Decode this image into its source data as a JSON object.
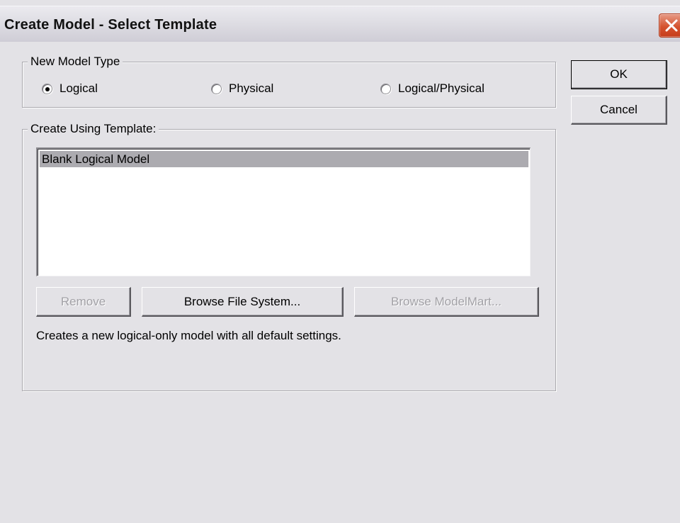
{
  "window": {
    "title": "Create Model - Select Template"
  },
  "model_type": {
    "legend": "New Model Type",
    "options": [
      {
        "label": "Logical",
        "selected": true
      },
      {
        "label": "Physical",
        "selected": false
      },
      {
        "label": "Logical/Physical",
        "selected": false
      }
    ]
  },
  "template": {
    "legend": "Create Using Template:",
    "items": [
      "Blank Logical Model"
    ],
    "selected_index": 0,
    "buttons": {
      "remove": "Remove",
      "browse_fs": "Browse File System...",
      "browse_mm": "Browse ModelMart..."
    },
    "description": "Creates a new logical-only model with all default settings."
  },
  "actions": {
    "ok": "OK",
    "cancel": "Cancel"
  },
  "colors": {
    "dialog_bg": "#e3e2e6",
    "close_button": "#d5532f",
    "selection": "#acabb0"
  }
}
